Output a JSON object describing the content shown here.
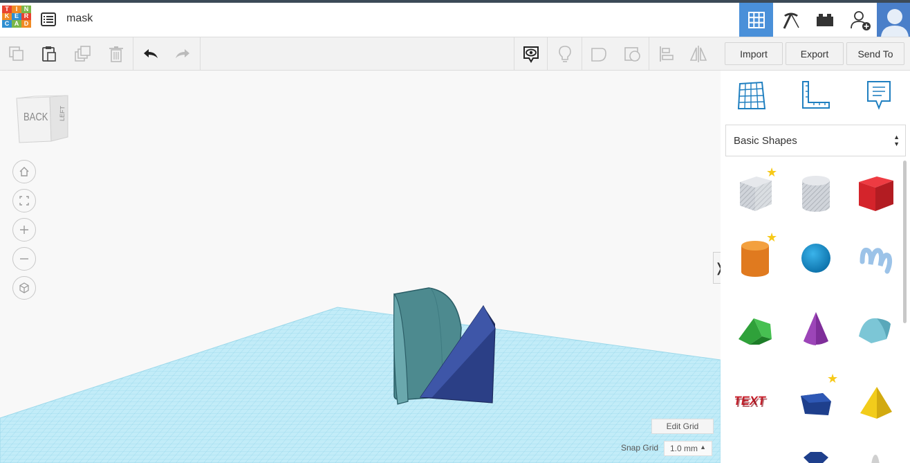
{
  "header": {
    "logo_letters": [
      "T",
      "I",
      "N",
      "K",
      "E",
      "R",
      "C",
      "A",
      "D"
    ],
    "design_title": "mask",
    "icons": [
      "grid-view-icon",
      "pickaxe-icon",
      "bricks-icon",
      "add-user-icon",
      "user-avatar"
    ]
  },
  "toolbar": {
    "actions": [
      "copy-icon",
      "paste-icon",
      "duplicate-icon",
      "delete-icon",
      "undo-icon",
      "redo-icon"
    ],
    "view_actions": [
      "notes-visibility-icon",
      "light-bulb-icon",
      "group-icon",
      "hole-icon",
      "align-icon",
      "mirror-icon"
    ],
    "import_label": "Import",
    "export_label": "Export",
    "send_to_label": "Send To"
  },
  "viewcube": {
    "back_label": "BACK",
    "left_label": "LEFT"
  },
  "nav_buttons": [
    "home-view-icon",
    "fit-all-icon",
    "zoom-in-icon",
    "zoom-out-icon",
    "perspective-icon"
  ],
  "workplane": {
    "edit_grid_label": "Edit Grid",
    "snap_grid_label": "Snap Grid",
    "snap_grid_value": "1.0 mm",
    "collapse_glyph": "❭"
  },
  "panel": {
    "tools": [
      "workplane-icon",
      "ruler-icon",
      "notes-icon"
    ],
    "category": "Basic Shapes",
    "shapes": [
      {
        "name": "Box Hole",
        "starred": true
      },
      {
        "name": "Cylinder Hole",
        "starred": false
      },
      {
        "name": "Box",
        "starred": false
      },
      {
        "name": "Cylinder",
        "starred": true
      },
      {
        "name": "Sphere",
        "starred": false
      },
      {
        "name": "Scribble",
        "starred": false
      },
      {
        "name": "Roof",
        "starred": false
      },
      {
        "name": "Cone",
        "starred": false
      },
      {
        "name": "Round Roof",
        "starred": false
      },
      {
        "name": "Text",
        "starred": false
      },
      {
        "name": "Shape Generators",
        "starred": true
      },
      {
        "name": "Pyramid",
        "starred": false
      }
    ]
  },
  "colors": {
    "accent": "#4a90d9",
    "workplane_grid": "#a8dcec",
    "shape_teal": "#4d8a8f",
    "shape_navy": "#2b3f86"
  }
}
